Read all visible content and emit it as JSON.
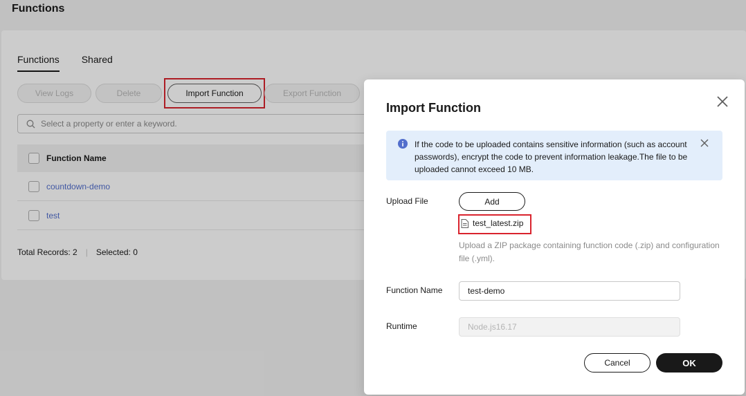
{
  "page": {
    "title": "Functions"
  },
  "tabs": [
    {
      "label": "Functions",
      "active": true
    },
    {
      "label": "Shared",
      "active": false
    }
  ],
  "toolbar": {
    "view_logs": "View Logs",
    "delete": "Delete",
    "import_function": "Import Function",
    "export_function": "Export Function"
  },
  "search": {
    "placeholder": "Select a property or enter a keyword."
  },
  "table": {
    "header": "Function Name",
    "rows": [
      {
        "name": "countdown-demo"
      },
      {
        "name": "test"
      }
    ]
  },
  "footer": {
    "total": "Total Records: 2",
    "selected": "Selected: 0"
  },
  "dialog": {
    "title": "Import Function",
    "alert": "If the code to be uploaded contains sensitive information (such as account passwords), encrypt the code to prevent information leakage.The file to be uploaded cannot exceed 10 MB.",
    "upload_label": "Upload File",
    "add_label": "Add",
    "file_name": "test_latest.zip",
    "upload_hint": "Upload a ZIP package containing function code (.zip) and configuration file (.yml).",
    "function_name_label": "Function Name",
    "function_name_value": "test-demo",
    "runtime_label": "Runtime",
    "runtime_value": "Node.js16.17",
    "cancel_label": "Cancel",
    "ok_label": "OK"
  },
  "colors": {
    "link": "#526ecc",
    "highlight": "#d9232d",
    "alert_bg": "#e3eefb",
    "info_icon": "#526ecc",
    "primary_button": "#191919"
  }
}
